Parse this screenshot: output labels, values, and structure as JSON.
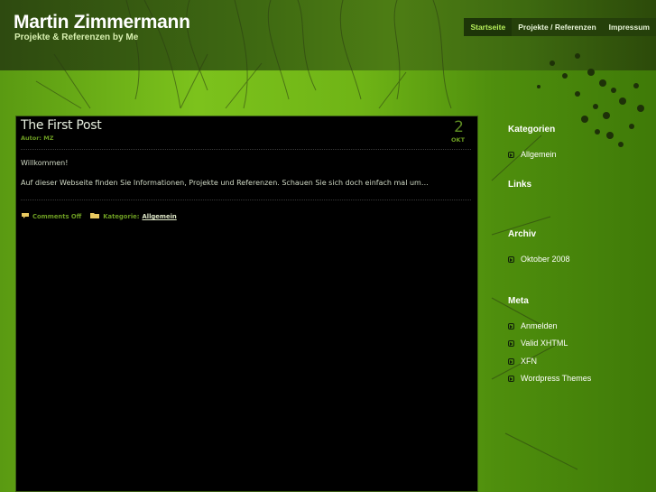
{
  "header": {
    "title": "Martin Zimmermann",
    "tagline": "Projekte & Referenzen by Me",
    "nav": [
      {
        "label": "Startseite",
        "active": true
      },
      {
        "label": "Projekte / Referenzen",
        "active": false
      },
      {
        "label": "Impressum",
        "active": false
      }
    ]
  },
  "post": {
    "title": "The First Post",
    "author": "Autor: MZ",
    "date_day": "2",
    "date_month": "OKT",
    "paragraphs": [
      "Willkommen!",
      "Auf dieser Webseite finden Sie Informationen, Projekte und Referenzen. Schauen Sie sich doch einfach mal um…"
    ],
    "comments": "Comments Off",
    "category_label": "Kategorie:",
    "category_link": "Allgemein"
  },
  "sidebar": {
    "kategorien": {
      "heading": "Kategorien",
      "items": [
        "Allgemein"
      ]
    },
    "links": {
      "heading": "Links"
    },
    "archiv": {
      "heading": "Archiv",
      "items": [
        "Oktober 2008"
      ]
    },
    "meta": {
      "heading": "Meta",
      "items": [
        "Anmelden",
        "Valid XHTML",
        "XFN",
        "Wordpress Themes"
      ]
    }
  },
  "colors": {
    "accent": "#b6ef5a",
    "meta_green": "#6c9c22",
    "panel": "#000000"
  }
}
